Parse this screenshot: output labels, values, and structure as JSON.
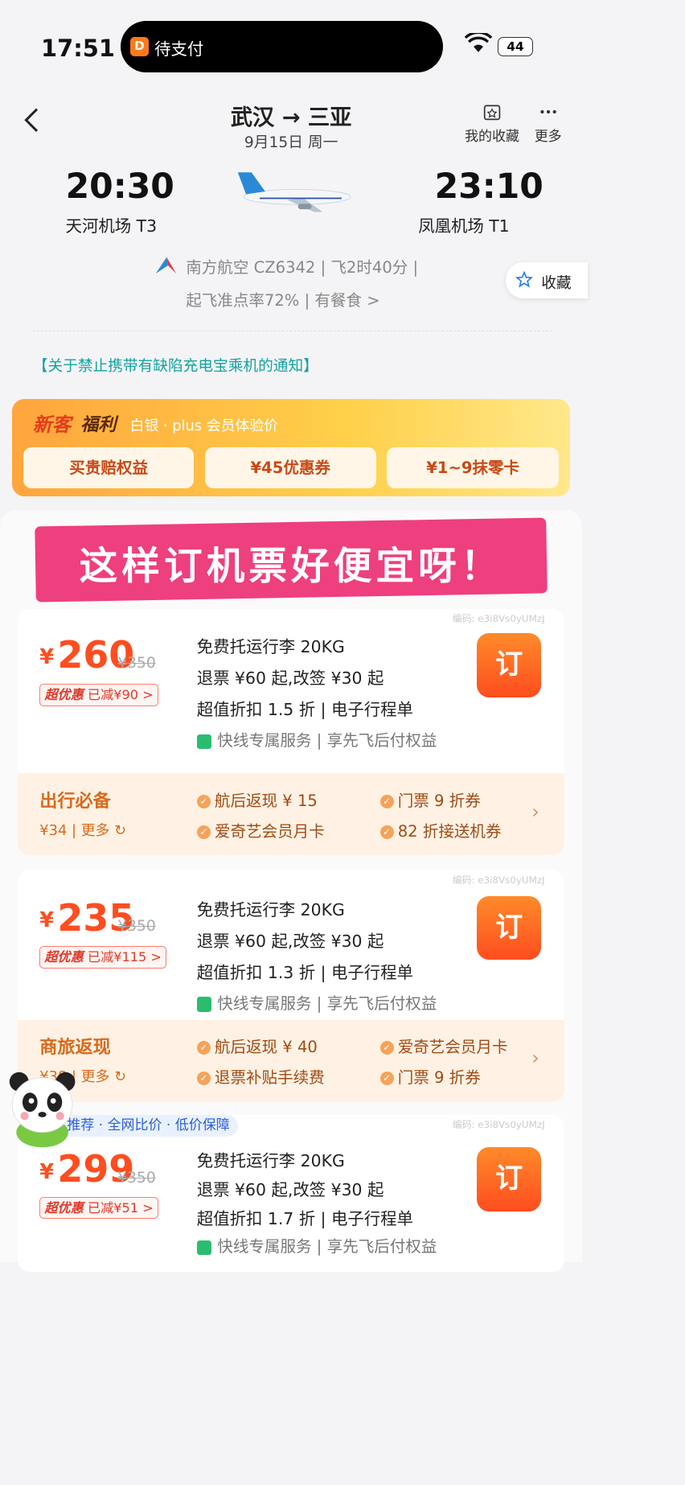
{
  "status": {
    "time": "17:51",
    "island_text": "待支付",
    "battery": "44"
  },
  "header": {
    "route": "武汉 → 三亚",
    "date": "9月15日  周一",
    "fav_label": "我的收藏",
    "more_label": "更多"
  },
  "flight": {
    "dep_time": "20:30",
    "dep_airport": "天河机场 T3",
    "arr_time": "23:10",
    "arr_airport": "凤凰机场 T1",
    "airline_info": "南方航空 CZ6342 | 飞2时40分 |",
    "ontime_info": "起飞准点率72% | 有餐食 >",
    "fav_float": "收藏"
  },
  "notice": "【关于禁止携带有缺陷充电宝乘机的通知】",
  "promo": {
    "title_new": "新客",
    "title_benefit": "福利",
    "subtitle": "白银 · plus 会员体验价",
    "buttons": [
      "买贵赔权益",
      "¥45优惠券",
      "¥1~9抹零卡"
    ]
  },
  "banner": "这样订机票好便宜呀！",
  "cards": [
    {
      "code": "编码: e3i8Vs0yUMzJ",
      "price_symbol": "¥",
      "price": "260",
      "original": "¥350",
      "badge_a": "超优惠",
      "badge_b": "已减¥90 >",
      "lines": [
        "免费托运行李 20KG",
        "退票 ¥60 起,改签 ¥30 起",
        "超值折扣 1.5 折 | 电子行程单"
      ],
      "service": "快线专属服务 | 享先飞后付权益",
      "order": "订",
      "extras_title": "出行必备",
      "extras_price": "¥34 | 更多 ↻",
      "extras_items": [
        "航后返现 ¥ 15",
        "门票 9 折券",
        "爱奇艺会员月卡",
        "82 折接送机券"
      ]
    },
    {
      "code": "编码: e3i8Vs0yUMzJ",
      "price_symbol": "¥",
      "price": "235",
      "original": "¥350",
      "badge_a": "超优惠",
      "badge_b": "已减¥115 >",
      "lines": [
        "免费托运行李 20KG",
        "退票 ¥60 起,改签 ¥30 起",
        "超值折扣 1.3 折 | 电子行程单"
      ],
      "service": "快线专属服务 | 享先飞后付权益",
      "order": "订",
      "extras_title": "商旅返现",
      "extras_price": "¥38 | 更多 ↻",
      "extras_items": [
        "航后返现 ¥ 40",
        "爱奇艺会员月卡",
        "退票补贴手续费",
        "门票 9 折券"
      ]
    },
    {
      "code": "编码: e3i8Vs0yUMzJ",
      "tag": "推荐 · 全网比价 · 低价保障",
      "price_symbol": "¥",
      "price": "299",
      "original": "¥350",
      "badge_a": "超优惠",
      "badge_b": "已减¥51 >",
      "lines": [
        "免费托运行李 20KG",
        "退票 ¥60 起,改签 ¥30 起",
        "超值折扣 1.7 折 | 电子行程单"
      ],
      "service": "快线专属服务 | 享先飞后付权益",
      "order": "订"
    }
  ]
}
